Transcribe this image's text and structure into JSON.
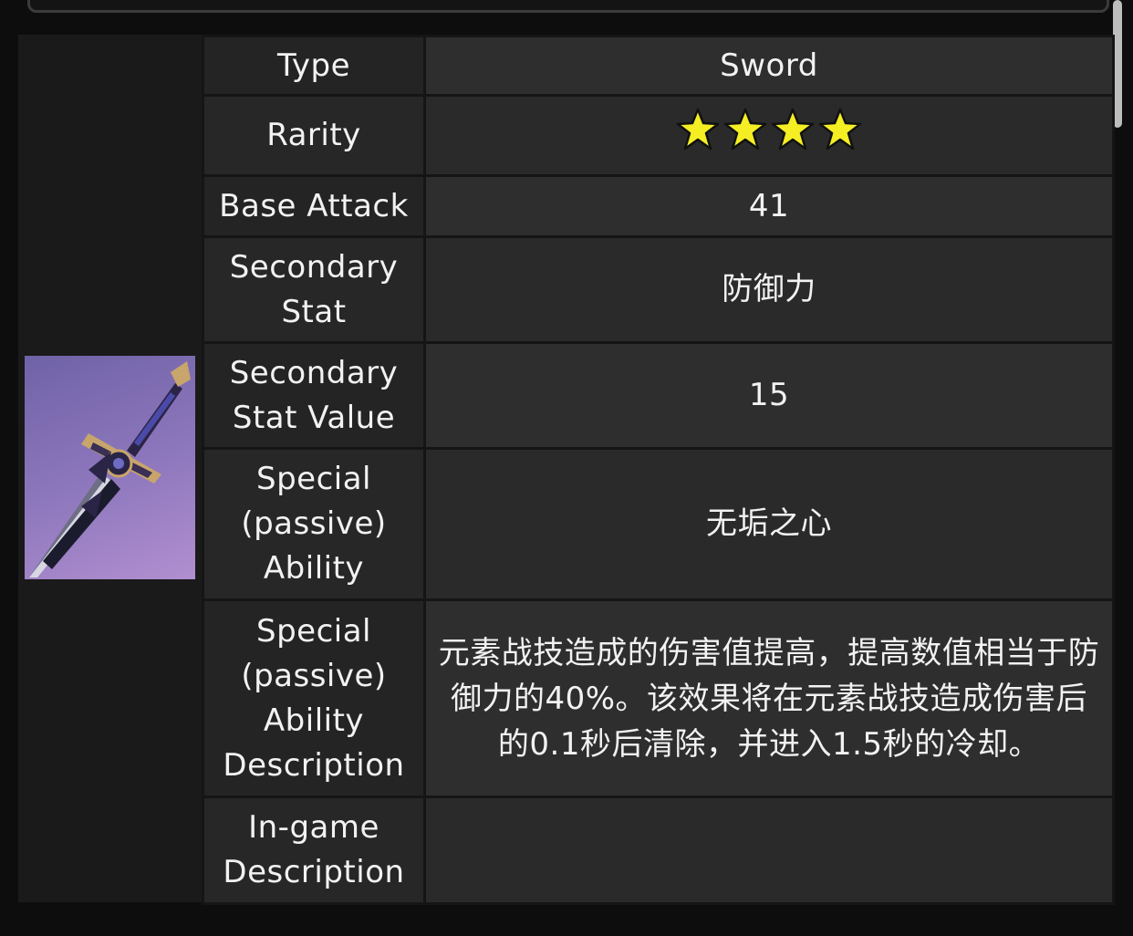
{
  "rows": [
    {
      "label": "Type",
      "value": "Sword"
    },
    {
      "label": "Rarity",
      "value": "",
      "stars": 4
    },
    {
      "label": "Base Attack",
      "value": "41"
    },
    {
      "label": "Secondary Stat",
      "value": "防御力"
    },
    {
      "label": "Secondary Stat Value",
      "value": "15"
    },
    {
      "label": "Special (passive) Ability",
      "value": "无垢之心"
    },
    {
      "label": "Special (passive) Ability Description",
      "value": "元素战技造成的伤害值提高，提高数值相当于防御力的40%。该效果将在元素战技造成伤害后的0.1秒后清除，并进入1.5秒的冷却。"
    },
    {
      "label": "In-game Description",
      "value": ""
    }
  ],
  "colors": {
    "accent": "#e0c043",
    "star": "#f5ee23"
  },
  "icons": {
    "star": "star-icon",
    "weapon": "sword-image"
  }
}
